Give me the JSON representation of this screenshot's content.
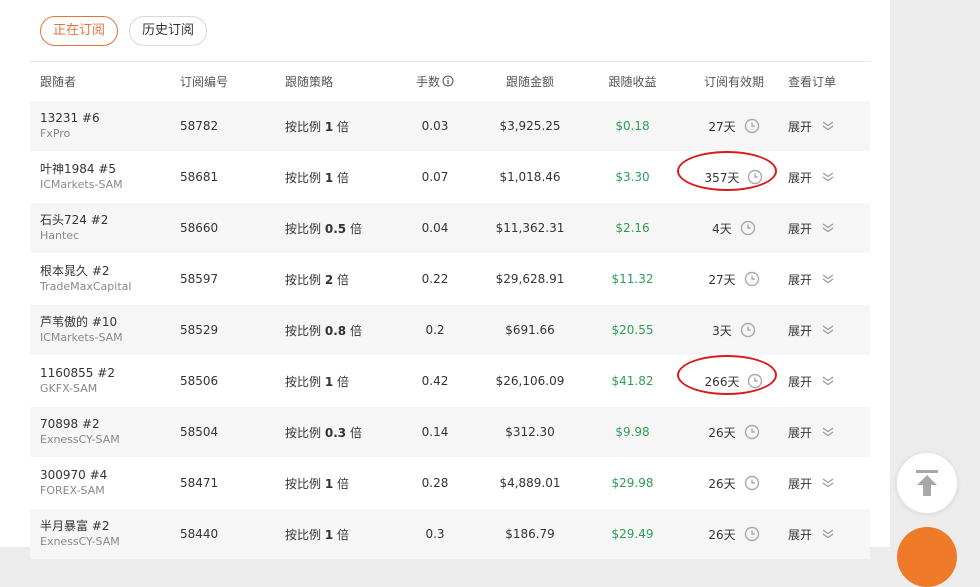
{
  "tabs": {
    "current": "正在订阅",
    "history": "历史订阅"
  },
  "columns": [
    "跟随者",
    "订阅编号",
    "跟随策略",
    "手数",
    "跟随金额",
    "跟随收益",
    "订阅有效期",
    "查看订单"
  ],
  "strategy_prefix": "按比例",
  "strategy_suffix": "倍",
  "rows": [
    {
      "name": "13231 #6",
      "broker": "FxPro",
      "id": "58782",
      "mult": "1",
      "lots": "0.03",
      "amount": "$3,925.25",
      "profit": "$0.18",
      "days": "27天",
      "expand": "展开"
    },
    {
      "name": "叶神1984 #5",
      "broker": "ICMarkets-SAM",
      "id": "58681",
      "mult": "1",
      "lots": "0.07",
      "amount": "$1,018.46",
      "profit": "$3.30",
      "days": "357天",
      "expand": "展开"
    },
    {
      "name": "石头724 #2",
      "broker": "Hantec",
      "id": "58660",
      "mult": "0.5",
      "lots": "0.04",
      "amount": "$11,362.31",
      "profit": "$2.16",
      "days": "4天",
      "expand": "展开"
    },
    {
      "name": "根本晁久 #2",
      "broker": "TradeMaxCapital",
      "id": "58597",
      "mult": "2",
      "lots": "0.22",
      "amount": "$29,628.91",
      "profit": "$11.32",
      "days": "27天",
      "expand": "展开"
    },
    {
      "name": "芦苇傲的 #10",
      "broker": "ICMarkets-SAM",
      "id": "58529",
      "mult": "0.8",
      "lots": "0.2",
      "amount": "$691.66",
      "profit": "$20.55",
      "days": "3天",
      "expand": "展开"
    },
    {
      "name": "1160855 #2",
      "broker": "GKFX-SAM",
      "id": "58506",
      "mult": "1",
      "lots": "0.42",
      "amount": "$26,106.09",
      "profit": "$41.82",
      "days": "266天",
      "expand": "展开"
    },
    {
      "name": "70898 #2",
      "broker": "ExnessCY-SAM",
      "id": "58504",
      "mult": "0.3",
      "lots": "0.14",
      "amount": "$312.30",
      "profit": "$9.98",
      "days": "26天",
      "expand": "展开"
    },
    {
      "name": "300970 #4",
      "broker": "FOREX-SAM",
      "id": "58471",
      "mult": "1",
      "lots": "0.28",
      "amount": "$4,889.01",
      "profit": "$29.98",
      "days": "26天",
      "expand": "展开"
    },
    {
      "name": "半月暴富 #2",
      "broker": "ExnessCY-SAM",
      "id": "58440",
      "mult": "1",
      "lots": "0.3",
      "amount": "$186.79",
      "profit": "$29.49",
      "days": "26天",
      "expand": "展开"
    }
  ],
  "icons": {
    "clock": "clock-icon",
    "chevron": "chevron-double-down-icon",
    "info": "info-icon",
    "back_to_top": "arrow-up-to-line-icon"
  },
  "colors": {
    "accent": "#e8733b",
    "profit": "#2e9e57",
    "highlight": "#d81c1c"
  }
}
